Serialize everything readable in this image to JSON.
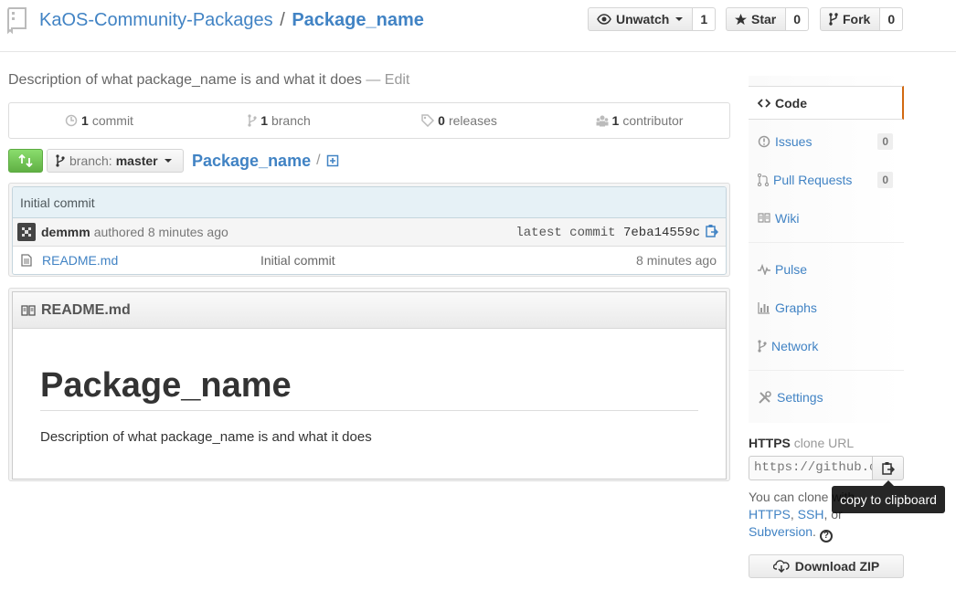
{
  "header": {
    "owner": "KaOS-Community-Packages",
    "separator": "/",
    "repo": "Package_name",
    "watch": {
      "label": "Unwatch",
      "count": "1"
    },
    "star": {
      "label": "Star",
      "count": "0"
    },
    "fork": {
      "label": "Fork",
      "count": "0"
    }
  },
  "description": {
    "text": "Description of what package_name is and what it does",
    "edit": "— Edit"
  },
  "summary": {
    "commits": {
      "count": "1",
      "label": "commit"
    },
    "branches": {
      "count": "1",
      "label": "branch"
    },
    "releases": {
      "count": "0",
      "label": "releases"
    },
    "contributors": {
      "count": "1",
      "label": "contributor"
    }
  },
  "file_nav": {
    "branch_prefix": "branch:",
    "branch": "master",
    "path": "Package_name",
    "slash": "/"
  },
  "commit": {
    "title": "Initial commit",
    "author": "demmm",
    "authored": "authored 8 minutes ago",
    "latest_label": "latest commit",
    "sha": "7eba14559c"
  },
  "files": [
    {
      "name": "README.md",
      "message": "Initial commit",
      "age": "8 minutes ago"
    }
  ],
  "readme": {
    "filename": "README.md",
    "heading": "Package_name",
    "body": "Description of what package_name is and what it does"
  },
  "sidebar": {
    "code": "Code",
    "issues": {
      "label": "Issues",
      "count": "0"
    },
    "pulls": {
      "label": "Pull Requests",
      "count": "0"
    },
    "wiki": "Wiki",
    "pulse": "Pulse",
    "graphs": "Graphs",
    "network": "Network",
    "settings": "Settings"
  },
  "clone": {
    "protocol": "HTTPS",
    "label": "clone URL",
    "url": "https://github.com/KaOS-Community-Packages/Package_name.git",
    "help_prefix": "You can clone with",
    "https": "HTTPS",
    "ssh": "SSH",
    "or": ", or",
    "subversion": "Subversion",
    "tooltip": "copy to clipboard",
    "download": "Download ZIP"
  },
  "colors": {
    "link": "#4183c4",
    "accent_orange": "#d26911",
    "compare_green": "#6cc644"
  }
}
